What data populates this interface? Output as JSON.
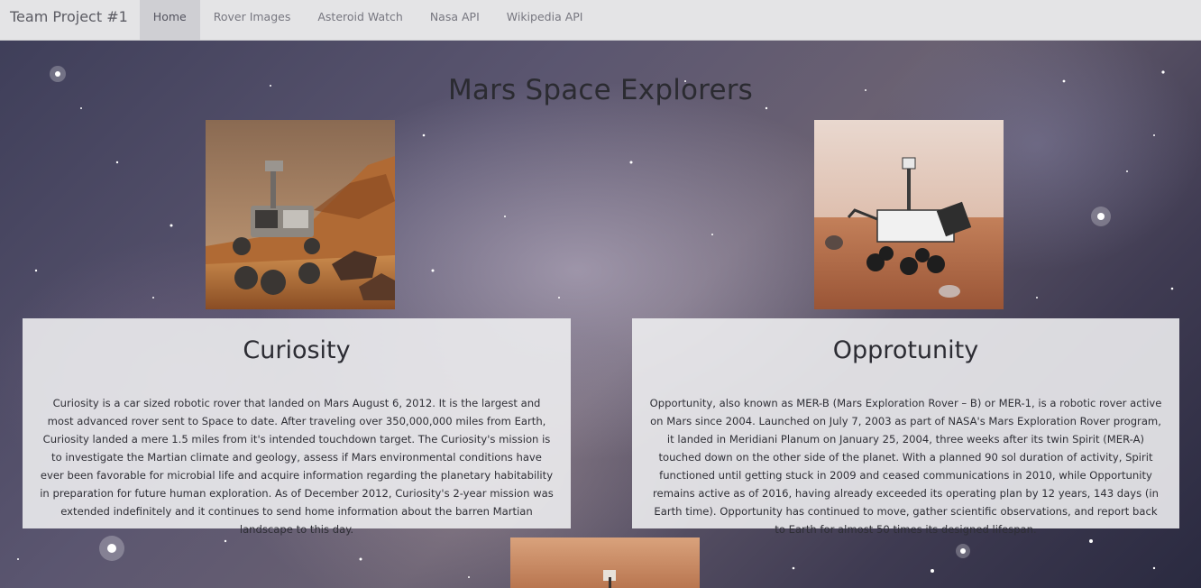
{
  "navbar": {
    "brand": "Team Project #1",
    "items": [
      {
        "label": "Home",
        "active": true
      },
      {
        "label": "Rover Images",
        "active": false
      },
      {
        "label": "Asteroid Watch",
        "active": false
      },
      {
        "label": "Nasa API",
        "active": false
      },
      {
        "label": "Wikipedia API",
        "active": false
      }
    ]
  },
  "page": {
    "title": "Mars Space Explorers"
  },
  "rovers": [
    {
      "name": "Curiosity",
      "description": "Curiosity is a car sized robotic rover that landed on Mars August 6, 2012. It is the largest and most advanced rover sent to Space to date. After traveling over 350,000,000 miles from Earth, Curiosity landed a mere 1.5 miles from it's intended touchdown target. The Curiosity's mission is to investigate the Martian climate and geology, assess if Mars environmental conditions have ever been favorable for microbial life and acquire information regarding the planetary habitability in preparation for future human exploration. As of December 2012, Curiosity's 2-year mission was extended indefinitely and it continues to send home information about the barren Martian landscape to this day."
    },
    {
      "name": "Opprotunity",
      "description": "Opportunity, also known as MER-B (Mars Exploration Rover – B) or MER-1, is a robotic rover active on Mars since 2004. Launched on July 7, 2003 as part of NASA's Mars Exploration Rover program, it landed in Meridiani Planum on January 25, 2004, three weeks after its twin Spirit (MER-A) touched down on the other side of the planet. With a planned 90 sol duration of activity, Spirit functioned until getting stuck in 2009 and ceased communications in 2010, while Opportunity remains active as of 2016, having already exceeded its operating plan by 12 years, 143 days (in Earth time). Opportunity has continued to move, gather scientific observations, and report back to Earth for almost 50 times its designed lifespan."
    }
  ],
  "colors": {
    "navbar_bg": "#e4e4e6",
    "nav_active_bg": "#cfcfd3",
    "card_bg": "#ececee",
    "title_text": "#2b2b31"
  }
}
